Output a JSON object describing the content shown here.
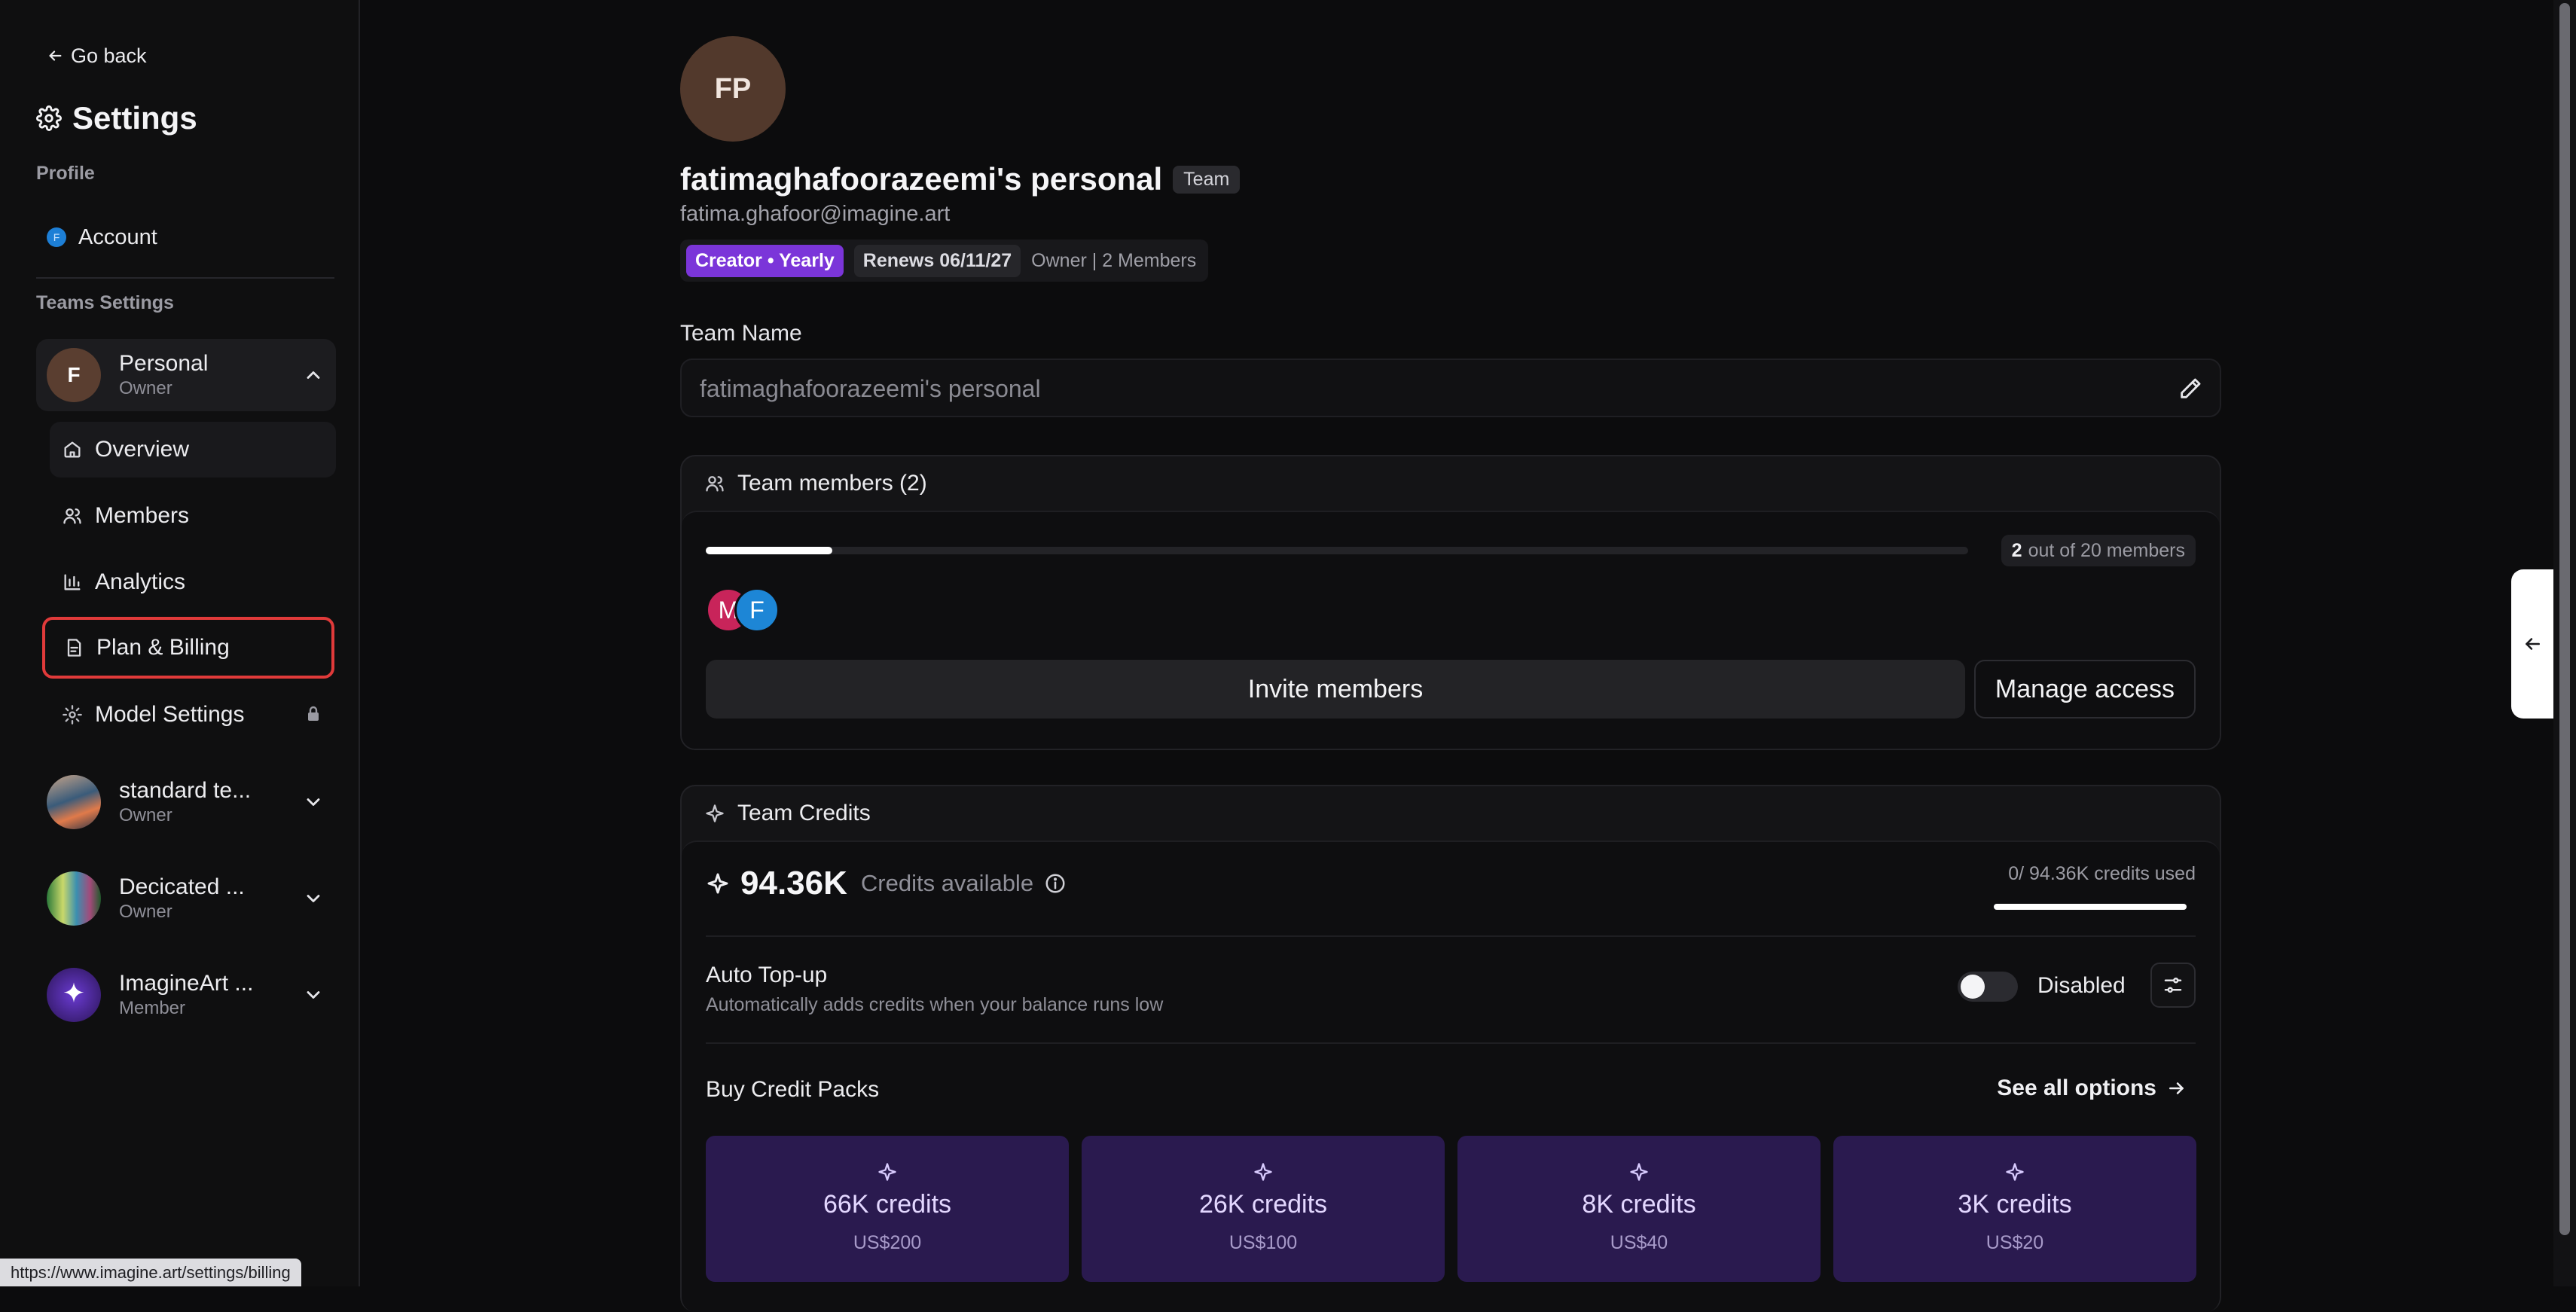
{
  "sidebar": {
    "go_back": "Go back",
    "title": "Settings",
    "profile_label": "Profile",
    "account": {
      "avatar": "F",
      "label": "Account"
    },
    "teams_label": "Teams Settings",
    "active_team": {
      "avatar": "F",
      "name": "Personal",
      "role": "Owner"
    },
    "nav": [
      {
        "label": "Overview",
        "icon": "home-icon"
      },
      {
        "label": "Members",
        "icon": "users-icon"
      },
      {
        "label": "Analytics",
        "icon": "analytics-icon"
      },
      {
        "label": "Plan & Billing",
        "icon": "billing-icon"
      },
      {
        "label": "Model Settings",
        "icon": "gear-icon"
      }
    ],
    "other_teams": [
      {
        "name": "standard te...",
        "role": "Owner"
      },
      {
        "name": "Decicated ...",
        "role": "Owner"
      },
      {
        "name": "ImagineArt ...",
        "role": "Member"
      }
    ]
  },
  "status_url": "https://www.imagine.art/settings/billing",
  "profile": {
    "initials": "FP",
    "team_title": "fatimaghafoorazeemi's personal",
    "team_badge": "Team",
    "email": "fatima.ghafoor@imagine.art",
    "plan_badge": "Creator • Yearly",
    "renew_badge": "Renews 06/11/27",
    "owner_info": "Owner | 2 Members"
  },
  "team_name": {
    "label": "Team Name",
    "value": "fatimaghafoorazeemi's personal"
  },
  "members_card": {
    "title": "Team members (2)",
    "count_bold": "2",
    "count_rest": "out of 20 members",
    "fill_fraction": 0.1,
    "avatars": [
      {
        "letter": "M",
        "color": "#c8245a"
      },
      {
        "letter": "F",
        "color": "#1d86d6"
      }
    ],
    "invite_label": "Invite members",
    "manage_label": "Manage access"
  },
  "credits_card": {
    "title": "Team Credits",
    "value": "94.36K",
    "available_label": "Credits available",
    "used_text": "0/ 94.36K credits used",
    "remaining_fraction": 1.0,
    "topup_title": "Auto Top-up",
    "topup_subtitle": "Automatically adds credits when your balance runs low",
    "toggle_label": "Disabled",
    "buy_title": "Buy Credit Packs",
    "see_all": "See all options",
    "packs": [
      {
        "credits": "66K credits",
        "price": "US$200"
      },
      {
        "credits": "26K credits",
        "price": "US$100"
      },
      {
        "credits": "8K credits",
        "price": "US$40"
      },
      {
        "credits": "3K credits",
        "price": "US$20"
      }
    ]
  },
  "colors": {
    "accent_purple": "#7b35d9",
    "pack_bg": "#2a1a4f",
    "selected_outline": "#e03a3a"
  }
}
